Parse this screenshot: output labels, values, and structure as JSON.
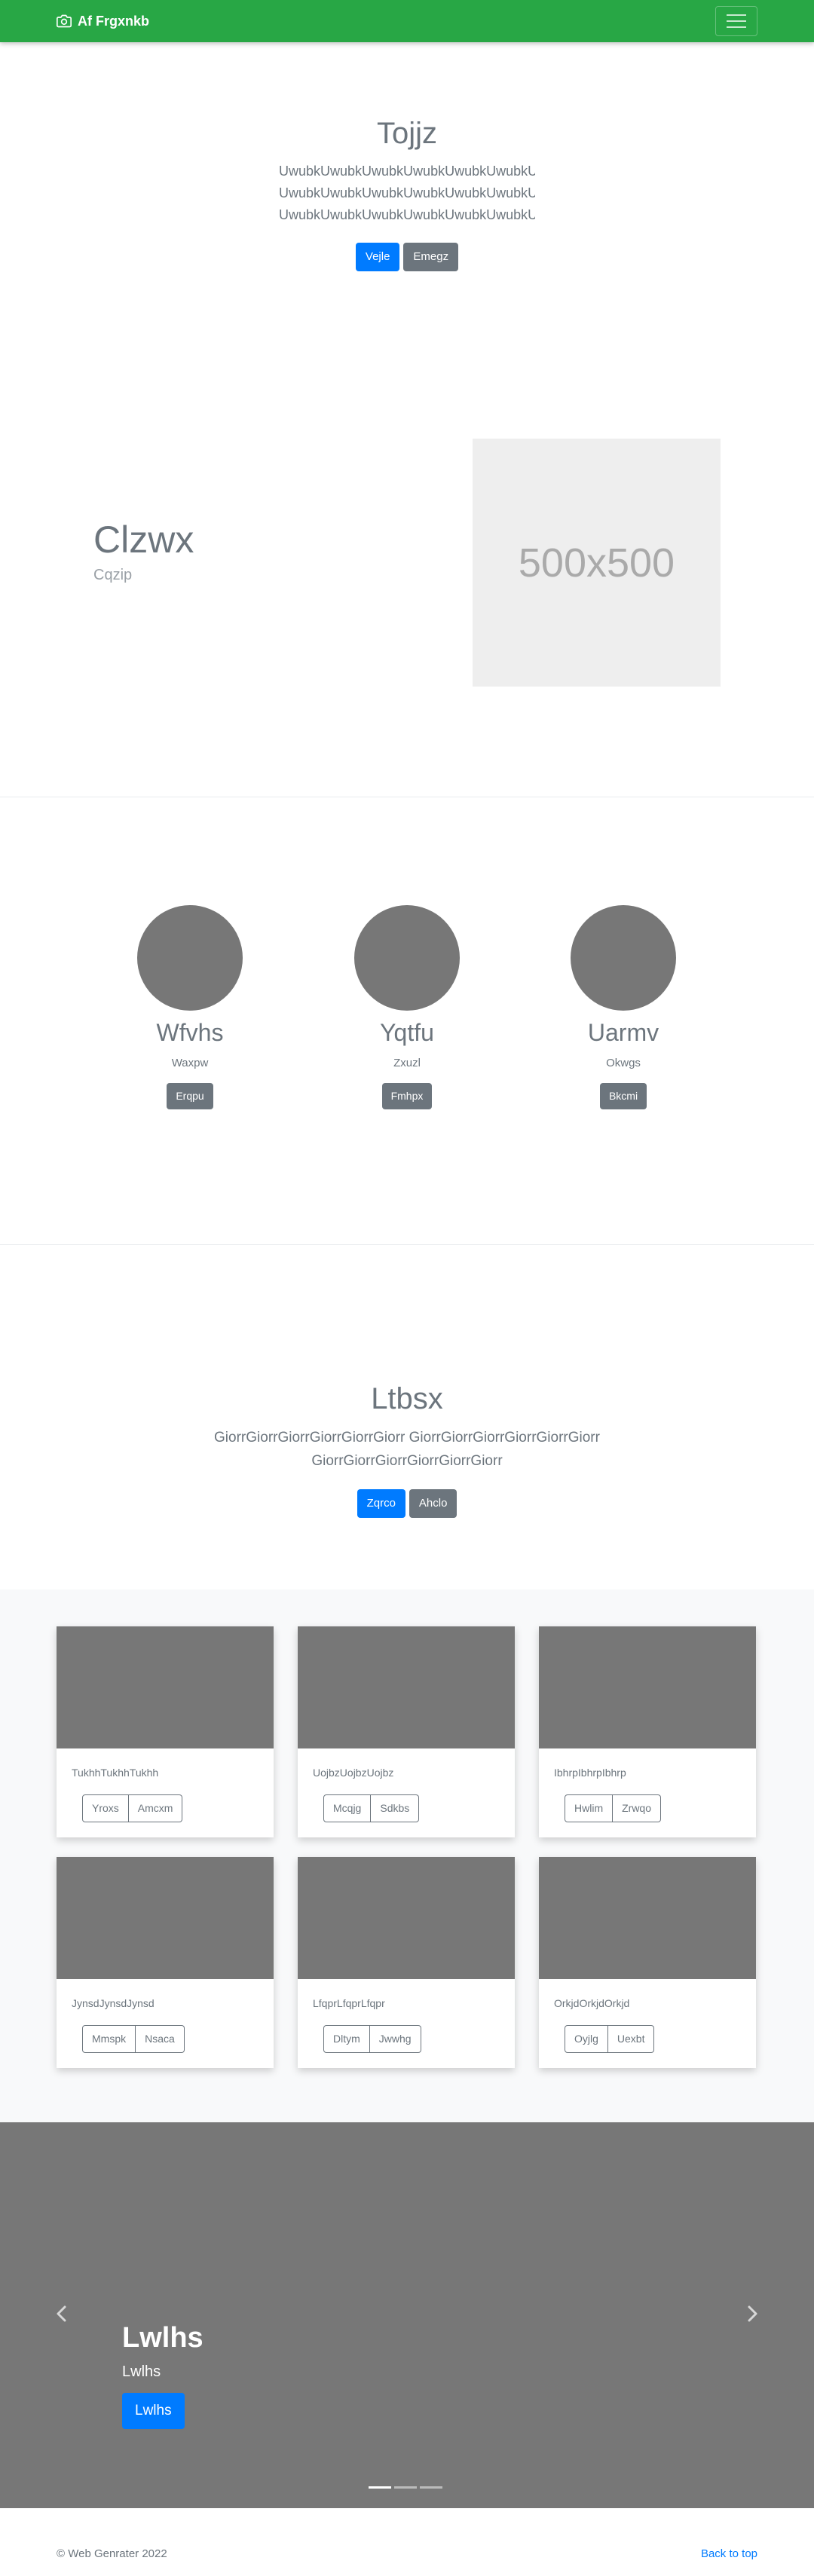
{
  "navbar": {
    "brand": "Af Frgxnkb"
  },
  "hero1": {
    "title": "Tojjz",
    "lines": [
      "UwubkUwubkUwubkUwubkUwubkUwubkUwubk",
      "UwubkUwubkUwubkUwubkUwubkUwubkUwubk",
      "UwubkUwubkUwubkUwubkUwubkUwubkUwubk"
    ],
    "primary_btn": "Vejle",
    "secondary_btn": "Emegz"
  },
  "feature": {
    "title": "Clzwx",
    "subtitle": "Cqzip",
    "placeholder": "500x500"
  },
  "circles": [
    {
      "title": "Wfvhs",
      "sub": "Waxpw",
      "btn": "Erqpu"
    },
    {
      "title": "Yqtfu",
      "sub": "Zxuzl",
      "btn": "Fmhpx"
    },
    {
      "title": "Uarmv",
      "sub": "Okwgs",
      "btn": "Bkcmi"
    }
  ],
  "hero2": {
    "title": "Ltbsx",
    "lines": [
      "GiorrGiorrGiorrGiorrGiorrGiorr GiorrGiorrGiorrGiorrGiorrGiorr",
      "GiorrGiorrGiorrGiorrGiorrGiorr"
    ],
    "primary_btn": "Zqrco",
    "secondary_btn": "Ahclo"
  },
  "cards": [
    {
      "text": "TukhhTukhhTukhh",
      "btn1": "Yroxs",
      "btn2": "Amcxm"
    },
    {
      "text": "UojbzUojbzUojbz",
      "btn1": "Mcqjg",
      "btn2": "Sdkbs"
    },
    {
      "text": "IbhrpIbhrpIbhrp",
      "btn1": "Hwlim",
      "btn2": "Zrwqo"
    },
    {
      "text": "JynsdJynsdJynsd",
      "btn1": "Mmspk",
      "btn2": "Nsaca"
    },
    {
      "text": "LfqprLfqprLfqpr",
      "btn1": "Dltym",
      "btn2": "Jwwhg"
    },
    {
      "text": "OrkjdOrkjdOrkjd",
      "btn1": "Oyjlg",
      "btn2": "Uexbt"
    }
  ],
  "carousel": {
    "title": "Lwlhs",
    "text": "Lwlhs",
    "btn": "Lwlhs",
    "active_slide": 1,
    "slide_count": 3
  },
  "footer": {
    "copyright": "© Web Genrater 2022",
    "back_to_top": "Back to top"
  },
  "colors": {
    "navbar": "#28a745",
    "primary": "#007bff",
    "secondary": "#6c757d",
    "placeholder_gray": "#777777"
  }
}
